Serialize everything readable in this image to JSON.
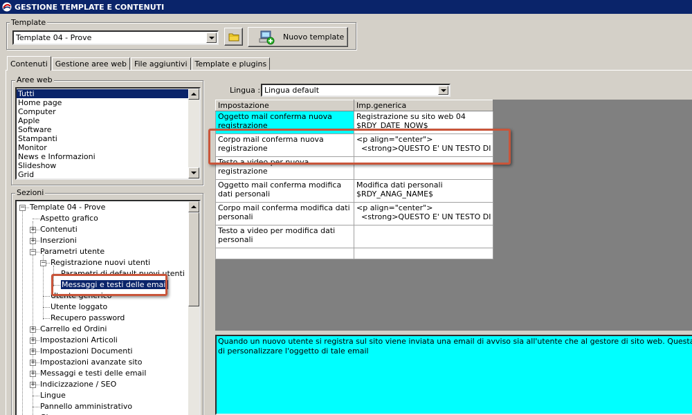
{
  "window": {
    "title": "GESTIONE TEMPLATE E CONTENUTI",
    "icon": "app-logo-icon"
  },
  "template_group": {
    "legend": "Template",
    "selected": "Template 04 - Prove",
    "open_folder_icon": "folder-icon",
    "new_template_label": "Nuovo template",
    "new_template_icon": "computer-add-icon"
  },
  "tabs": [
    {
      "label": "Contenuti",
      "active": true
    },
    {
      "label": "Gestione aree web"
    },
    {
      "label": "File aggiuntivi"
    },
    {
      "label": "Template e plugins"
    }
  ],
  "aree_web": {
    "legend": "Aree web",
    "items": [
      "Tutti",
      "Home page",
      "Computer",
      "Apple",
      "Software",
      "Stampanti",
      "Monitor",
      "News e Informazioni",
      "Slideshow",
      "Grid"
    ],
    "selected": "Tutti"
  },
  "sezioni": {
    "legend": "Sezioni",
    "items": [
      {
        "label": "Template 04 - Prove",
        "exp": "-"
      },
      {
        "label": "Aspetto grafico"
      },
      {
        "label": "Contenuti",
        "exp": "+"
      },
      {
        "label": "Inserzioni",
        "exp": "+"
      },
      {
        "label": "Parametri utente",
        "exp": "-"
      },
      {
        "label": "Registrazione nuovi utenti",
        "exp": "-"
      },
      {
        "label": "Parametri di default nuovi utenti"
      },
      {
        "label": "Messaggi e testi delle email",
        "selected": true
      },
      {
        "label": "Utente generico"
      },
      {
        "label": "Utente loggato"
      },
      {
        "label": "Recupero password"
      },
      {
        "label": "Carrello ed Ordini",
        "exp": "+"
      },
      {
        "label": "Impostazioni Articoli",
        "exp": "+"
      },
      {
        "label": "Impostazioni Documenti",
        "exp": "+"
      },
      {
        "label": "Impostazioni avanzate sito",
        "exp": "+"
      },
      {
        "label": "Messaggi e testi delle email",
        "exp": "+"
      },
      {
        "label": "Indicizzazione / SEO",
        "exp": "+"
      },
      {
        "label": "Lingue"
      },
      {
        "label": "Pannello amministrativo"
      },
      {
        "label": "Gl..."
      }
    ]
  },
  "lingua": {
    "label": "Lingua :",
    "selected": "Lingua default"
  },
  "grid": {
    "headers": [
      "Impostazione",
      "Imp.generica"
    ],
    "rows": [
      {
        "setting": "Oggetto mail conferma nuova registrazione",
        "value_line1": "Registrazione su sito web 04",
        "value_line2": "$RDY_DATE_NOW$",
        "cyan": true
      },
      {
        "setting": "Corpo mail conferma nuova registrazione",
        "value_line1": "<p align=\"center\">",
        "value_line2": "  <strong>QUESTO E' UN TESTO DI"
      },
      {
        "setting": "Testo a video per nuova registrazione",
        "value_line1": "",
        "value_line2": ""
      },
      {
        "setting": "Oggetto mail conferma modifica dati personali",
        "value_line1": "Modifica dati personali",
        "value_line2": "$RDY_ANAG_NAME$"
      },
      {
        "setting": "Corpo mail conferma modifica dati personali",
        "value_line1": "<p align=\"center\">",
        "value_line2": "  <strong>QUESTO E' UN TESTO DI"
      },
      {
        "setting": "Testo a video per modifica dati personali",
        "value_line1": "",
        "value_line2": ""
      }
    ]
  },
  "description": {
    "line1": "Quando un nuovo utente si registra sul sito viene inviata una email di avviso sia all'utente che al gestore di sito web. Questa impostazione conse",
    "line2": "di personalizzare l'oggetto di tale email"
  },
  "colors": {
    "titlebar": "#0a246a",
    "selection": "#0a246a",
    "cyan": "#00ffff",
    "annotation": "#c9553a",
    "face": "#d4d0c8"
  }
}
